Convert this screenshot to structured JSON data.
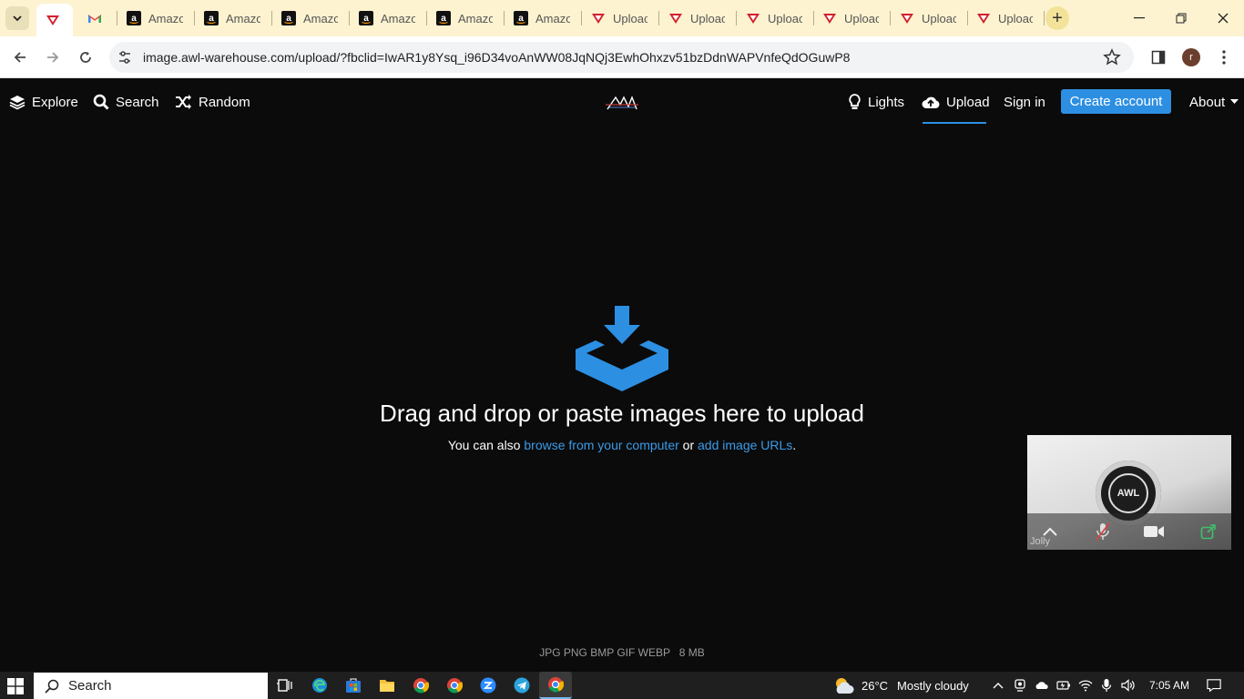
{
  "browser": {
    "tabs": [
      {
        "label": "",
        "favicon": "awl-icon",
        "active": true
      },
      {
        "label": "",
        "favicon": "gmail-icon"
      },
      {
        "label": "Amazo",
        "favicon": "amazon-icon"
      },
      {
        "label": "Amazo",
        "favicon": "amazon-icon"
      },
      {
        "label": "Amazo",
        "favicon": "amazon-icon"
      },
      {
        "label": "Amazo",
        "favicon": "amazon-icon"
      },
      {
        "label": "Amazo",
        "favicon": "amazon-icon"
      },
      {
        "label": "Amazo",
        "favicon": "amazon-icon"
      },
      {
        "label": "Uploac",
        "favicon": "awl-icon"
      },
      {
        "label": "Uploac",
        "favicon": "awl-icon"
      },
      {
        "label": "Uploac",
        "favicon": "awl-icon"
      },
      {
        "label": "Uploac",
        "favicon": "awl-icon"
      },
      {
        "label": "Uploac",
        "favicon": "awl-icon"
      },
      {
        "label": "Uploac",
        "favicon": "awl-icon"
      }
    ],
    "url": "image.awl-warehouse.com/upload/?fbclid=IwAR1y8Ysq_i96D34voAnWW08JqNQj3EwhOhxzv51bzDdnWAPVnfeQdOGuwP8",
    "profile_initial": "r"
  },
  "site": {
    "nav": {
      "explore": "Explore",
      "search": "Search",
      "random": "Random",
      "lights": "Lights",
      "upload": "Upload",
      "sign_in": "Sign in",
      "create_account": "Create account",
      "about": "About"
    },
    "logo_text": "AW",
    "dropzone": {
      "title": "Drag and drop or paste images here to upload",
      "sub_prefix": "You can also",
      "browse_link": "browse from your computer",
      "or": "or",
      "url_link": "add image URLs",
      "suffix": "."
    },
    "formats": "JPG PNG BMP GIF WEBP   8 MB",
    "accent_color": "#2d8fe2"
  },
  "video_widget": {
    "name": "Jolly",
    "coin_text": "AWL"
  },
  "taskbar": {
    "search_label": "Search",
    "weather_temp": "26°C",
    "weather_text": "Mostly cloudy",
    "time": "7:05 AM"
  }
}
